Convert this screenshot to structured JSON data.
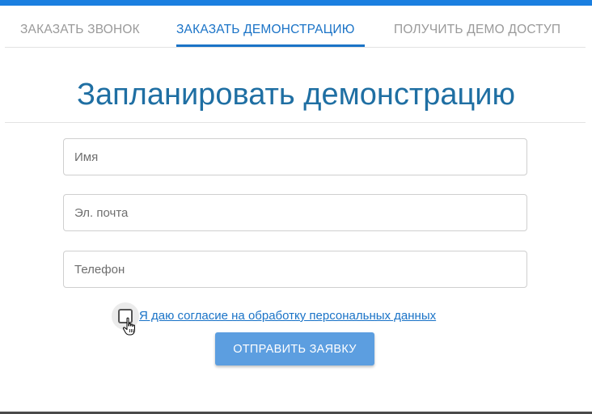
{
  "tabs": [
    {
      "label": "ЗАКАЗАТЬ ЗВОНОК",
      "active": false
    },
    {
      "label": "ЗАКАЗАТЬ ДЕМОНСТРАЦИЮ",
      "active": true
    },
    {
      "label": "ПОЛУЧИТЬ ДЕМО ДОСТУП",
      "active": false
    }
  ],
  "form": {
    "title": "Запланировать демонстрацию",
    "fields": {
      "name": {
        "value": "",
        "placeholder": "Имя"
      },
      "email": {
        "value": "",
        "placeholder": "Эл. почта"
      },
      "phone": {
        "value": "",
        "placeholder": "Телефон"
      }
    },
    "consent": {
      "label": "Я даю согласие на обработку персональных данных",
      "checked": false
    },
    "submit_label": "ОТПРАВИТЬ ЗАЯВКУ"
  },
  "colors": {
    "accent": "#1a73c7",
    "top_bar": "#1a7fe0",
    "button": "#5c9ee0",
    "title": "#1f6fa3"
  },
  "icons": {
    "cursor": "hand-pointer-icon"
  }
}
